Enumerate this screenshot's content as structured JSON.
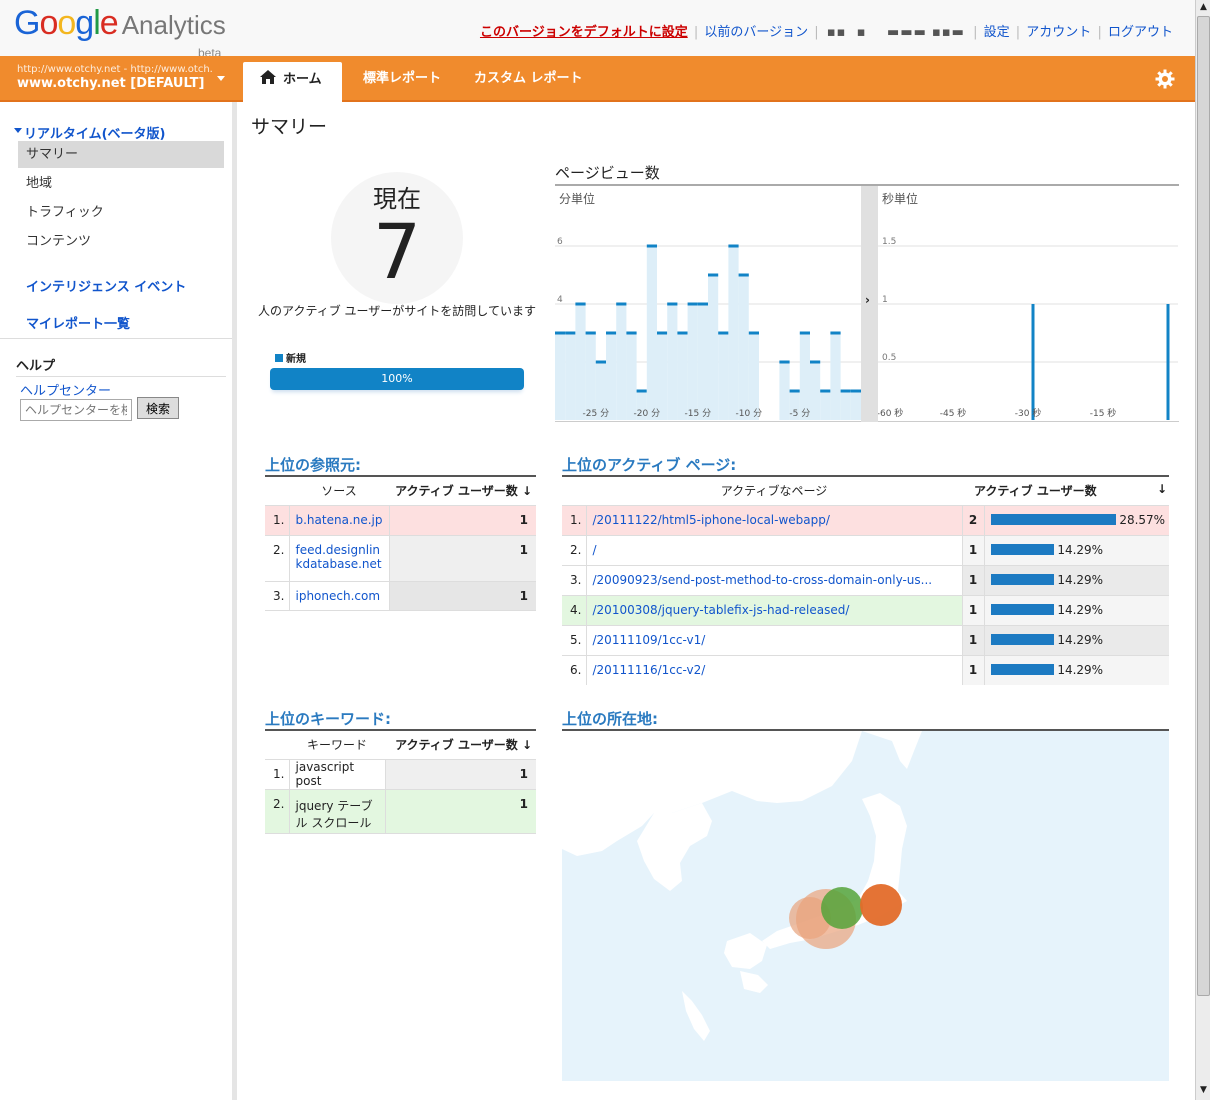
{
  "header": {
    "logo_google": "Google",
    "logo_analytics": "Analytics",
    "logo_beta": "beta",
    "links": [
      "このバージョンをデフォルトに設定",
      "以前のバージョン",
      "設定",
      "アカウント",
      "ログアウト"
    ]
  },
  "account": {
    "url": "http://www.otchy.net - http://www.otch...",
    "name": "www.otchy.net [DEFAULT]"
  },
  "tabs": [
    "ホーム",
    "標準レポート",
    "カスタム レポート"
  ],
  "sidebar": {
    "realtime": "リアルタイム(ベータ版)",
    "items": [
      "サマリー",
      "地域",
      "トラフィック",
      "コンテンツ"
    ],
    "intel": "インテリジェンス イベント",
    "myreports": "マイレポート一覧",
    "help": "ヘルプ",
    "helpcenter": "ヘルプセンター",
    "search_placeholder": "ヘルプセンターを検索",
    "search_btn": "検索"
  },
  "main": {
    "title": "サマリー",
    "now_label": "現在",
    "now_value": "7",
    "now_desc": "人のアクティブ ユーザーがサイトを訪問しています",
    "legend_new": "新規",
    "bar_pct": "100%",
    "pv_title": "ページビュー数",
    "per_min": "分単位",
    "per_sec": "秒単位",
    "referrers_title": "上位の参照元:",
    "pages_title": "上位のアクティブ ページ:",
    "keywords_title": "上位のキーワード:",
    "locations_title": "上位の所在地:"
  },
  "chart_data": [
    {
      "type": "bar",
      "title": "分単位",
      "x": [
        -29,
        -28,
        -27,
        -26,
        -25,
        -24,
        -23,
        -22,
        -21,
        -20,
        -19,
        -18,
        -17,
        -16,
        -15,
        -14,
        -13,
        -12,
        -11,
        -10,
        -9,
        -8,
        -7,
        -6,
        -5,
        -4,
        -3,
        -2,
        -1,
        0
      ],
      "values": [
        3,
        3,
        4,
        3,
        2,
        3,
        4,
        3,
        1,
        6,
        3,
        4,
        3,
        4,
        4,
        5,
        3,
        6,
        5,
        3,
        0,
        0,
        2,
        1,
        3,
        2,
        1,
        3,
        1,
        1
      ],
      "xticks": [
        "-25 分",
        "-20 分",
        "-15 分",
        "-10 分",
        "-5 分"
      ],
      "yticks": [
        "2",
        "4",
        "6"
      ],
      "ylim": [
        0,
        6
      ]
    },
    {
      "type": "bar",
      "title": "秒単位",
      "x": [
        -60,
        -50,
        -40,
        -30,
        -20,
        -10,
        0
      ],
      "xticks": [
        "-60 秒",
        "-45 秒",
        "-30 秒",
        "-15 秒"
      ],
      "yticks": [
        "0.5",
        "1",
        "1.5"
      ],
      "spikes": [
        -29,
        -2
      ],
      "spike_values": [
        1,
        1
      ],
      "ylim": [
        0,
        1.5
      ]
    }
  ],
  "referrers": {
    "headers": [
      "ソース",
      "アクティブ ユーザー数"
    ],
    "rows": [
      [
        "1.",
        "b.hatena.ne.jp",
        "1"
      ],
      [
        "2.",
        "feed.designlinkdatabase.net",
        "1"
      ],
      [
        "3.",
        "iphonech.com",
        "1"
      ]
    ]
  },
  "pages": {
    "headers": [
      "アクティブなページ",
      "アクティブ ユーザー数"
    ],
    "rows": [
      [
        "1.",
        "/20111122/html5-iphone-local-webapp/",
        "2",
        "28.57%"
      ],
      [
        "2.",
        "/",
        "1",
        "14.29%"
      ],
      [
        "3.",
        "/20090923/send-post-method-to-cross-domain-only-us...",
        "1",
        "14.29%"
      ],
      [
        "4.",
        "/20100308/jquery-tablefix-js-had-released/",
        "1",
        "14.29%"
      ],
      [
        "5.",
        "/20111109/1cc-v1/",
        "1",
        "14.29%"
      ],
      [
        "6.",
        "/20111116/1cc-v2/",
        "1",
        "14.29%"
      ]
    ]
  },
  "keywords": {
    "headers": [
      "キーワード",
      "アクティブ ユーザー数"
    ],
    "rows": [
      [
        "1.",
        "javascript post",
        "1"
      ],
      [
        "2.",
        "jquery テーブル スクロール",
        "1"
      ]
    ]
  }
}
